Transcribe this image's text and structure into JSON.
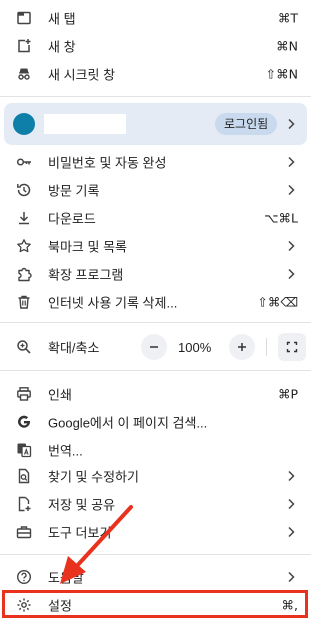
{
  "menu": {
    "new_tab": {
      "label": "새 탭",
      "shortcut": "⌘T"
    },
    "new_window": {
      "label": "새 창",
      "shortcut": "⌘N"
    },
    "new_incognito": {
      "label": "새 시크릿 창",
      "shortcut": "⇧⌘N"
    },
    "profile": {
      "signin_label": "로그인됨"
    },
    "passwords": {
      "label": "비밀번호 및 자동 완성"
    },
    "history": {
      "label": "방문 기록"
    },
    "downloads": {
      "label": "다운로드",
      "shortcut": "⌥⌘L"
    },
    "bookmarks": {
      "label": "북마크 및 목록"
    },
    "extensions": {
      "label": "확장 프로그램"
    },
    "clear_data": {
      "label": "인터넷 사용 기록 삭제...",
      "shortcut": "⇧⌘⌫"
    },
    "zoom": {
      "label": "확대/축소",
      "value": "100%",
      "minus": "−",
      "plus": "+"
    },
    "print": {
      "label": "인쇄",
      "shortcut": "⌘P"
    },
    "google_search": {
      "label": "Google에서 이 페이지 검색..."
    },
    "translate": {
      "label": "번역..."
    },
    "find_edit": {
      "label": "찾기 및 수정하기"
    },
    "save_share": {
      "label": "저장 및 공유"
    },
    "more_tools": {
      "label": "도구 더보기"
    },
    "help": {
      "label": "도움말"
    },
    "settings": {
      "label": "설정",
      "shortcut": "⌘,"
    }
  },
  "colors": {
    "profile_bg": "#e5ebf4",
    "avatar": "#0d7fa9",
    "highlight": "#e8321e"
  }
}
